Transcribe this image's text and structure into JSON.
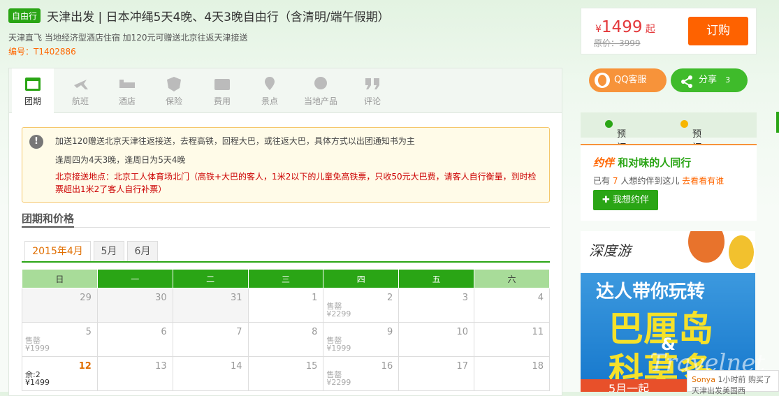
{
  "header": {
    "tag": "自由行",
    "title": "天津出发 | 日本冲绳5天4晚、4天3晚自由行（含清明/端午假期）",
    "subtitle": "天津直飞 当地经济型酒店住宿 加120元可赠送北京往返天津接送",
    "code": "编号：T1402886"
  },
  "price": {
    "currency": "¥",
    "amount": "1499",
    "suffix": "起",
    "original": "原价：3999",
    "order_label": "订购"
  },
  "social": {
    "qq_label": "QQ客服",
    "share_label": "分享",
    "share_count": "3"
  },
  "steps": {
    "flow": "预订流程",
    "notice": "预订须知"
  },
  "companion": {
    "logo": "约伴",
    "title": "和对味的人同行",
    "prefix": "已有",
    "count": "7",
    "middle": "人想约伴到这儿",
    "link": "去看看有谁",
    "button": "我想约伴"
  },
  "ad": {
    "brand": "深度游",
    "line1": "达人带你玩转",
    "line2": "巴厘岛",
    "amp": "&",
    "line3": "科莫多",
    "bottom": "5月一起"
  },
  "chat": {
    "user": "Sonya",
    "time": "1小时前",
    "action": "购买了",
    "text": "天津出发美国西"
  },
  "watermark": "Travelnet",
  "tabs": [
    {
      "label": "团期",
      "icon": "calendar-icon"
    },
    {
      "label": "航班",
      "icon": "plane-icon"
    },
    {
      "label": "酒店",
      "icon": "bed-icon"
    },
    {
      "label": "保险",
      "icon": "shield-icon"
    },
    {
      "label": "费用",
      "icon": "money-icon"
    },
    {
      "label": "景点",
      "icon": "pin-icon"
    },
    {
      "label": "当地产品",
      "icon": "star-pin-icon"
    },
    {
      "label": "评论",
      "icon": "quote-icon"
    }
  ],
  "notice": {
    "line1": "加送120赠送北京天津往返接送，去程高铁，回程大巴，或往返大巴，具体方式以出团通知书为主",
    "line2": "逢周四为4天3晚，逢周日为5天4晚",
    "line3": "北京接送地点：北京工人体育场北门（高铁+大巴的客人，1米2以下的儿童免高铁票，只收50元大巴费，请客人自行衡量，到时检票超出1米2了客人自行补票）"
  },
  "section_title": "团期和价格",
  "months": [
    "2015年4月",
    "5月",
    "6月"
  ],
  "weekdays": [
    "日",
    "一",
    "二",
    "三",
    "四",
    "五",
    "六"
  ],
  "calendar": [
    [
      {
        "d": "29",
        "gray": true
      },
      {
        "d": "30",
        "gray": true
      },
      {
        "d": "31",
        "gray": true
      },
      {
        "d": "1"
      },
      {
        "d": "2",
        "s1": "售罄",
        "s2": "¥2299"
      },
      {
        "d": "3"
      },
      {
        "d": "4"
      }
    ],
    [
      {
        "d": "5",
        "s1": "售罄",
        "s2": "¥1999"
      },
      {
        "d": "6"
      },
      {
        "d": "7"
      },
      {
        "d": "8"
      },
      {
        "d": "9",
        "s1": "售罄",
        "s2": "¥1999"
      },
      {
        "d": "10"
      },
      {
        "d": "11"
      }
    ],
    [
      {
        "d": "12",
        "s1": "余:2",
        "s2": "¥1499",
        "hl": true
      },
      {
        "d": "13"
      },
      {
        "d": "14"
      },
      {
        "d": "15"
      },
      {
        "d": "16",
        "s1": "售罄",
        "s2": "¥2299"
      },
      {
        "d": "17"
      },
      {
        "d": "18"
      }
    ]
  ]
}
